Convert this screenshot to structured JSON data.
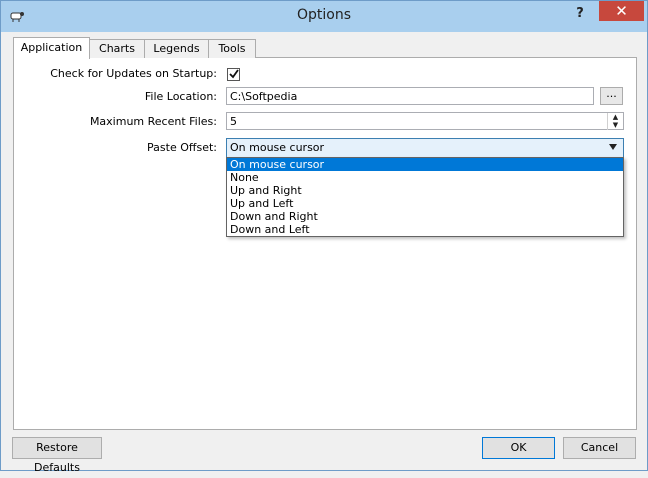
{
  "window": {
    "title": "Options",
    "help_label": "?",
    "close_label": "✕"
  },
  "tabs": [
    {
      "label": "Application",
      "active": true
    },
    {
      "label": "Charts",
      "active": false
    },
    {
      "label": "Legends",
      "active": false
    },
    {
      "label": "Tools",
      "active": false
    }
  ],
  "form": {
    "check_updates_label": "Check for Updates on Startup:",
    "check_updates_checked": true,
    "file_location_label": "File Location:",
    "file_location_value": "C:\\Softpedia",
    "browse_label": "...",
    "max_recent_label": "Maximum Recent Files:",
    "max_recent_value": "5",
    "paste_offset_label": "Paste Offset:",
    "paste_offset_value": "On mouse cursor",
    "paste_offset_options": [
      "On mouse cursor",
      "None",
      "Up and Right",
      "Up and Left",
      "Down and Right",
      "Down and Left"
    ]
  },
  "buttons": {
    "restore": "Restore Defaults",
    "ok": "OK",
    "cancel": "Cancel"
  },
  "colors": {
    "titlebar": "#a9cfee",
    "close": "#c7483d",
    "selection": "#0078d7"
  }
}
